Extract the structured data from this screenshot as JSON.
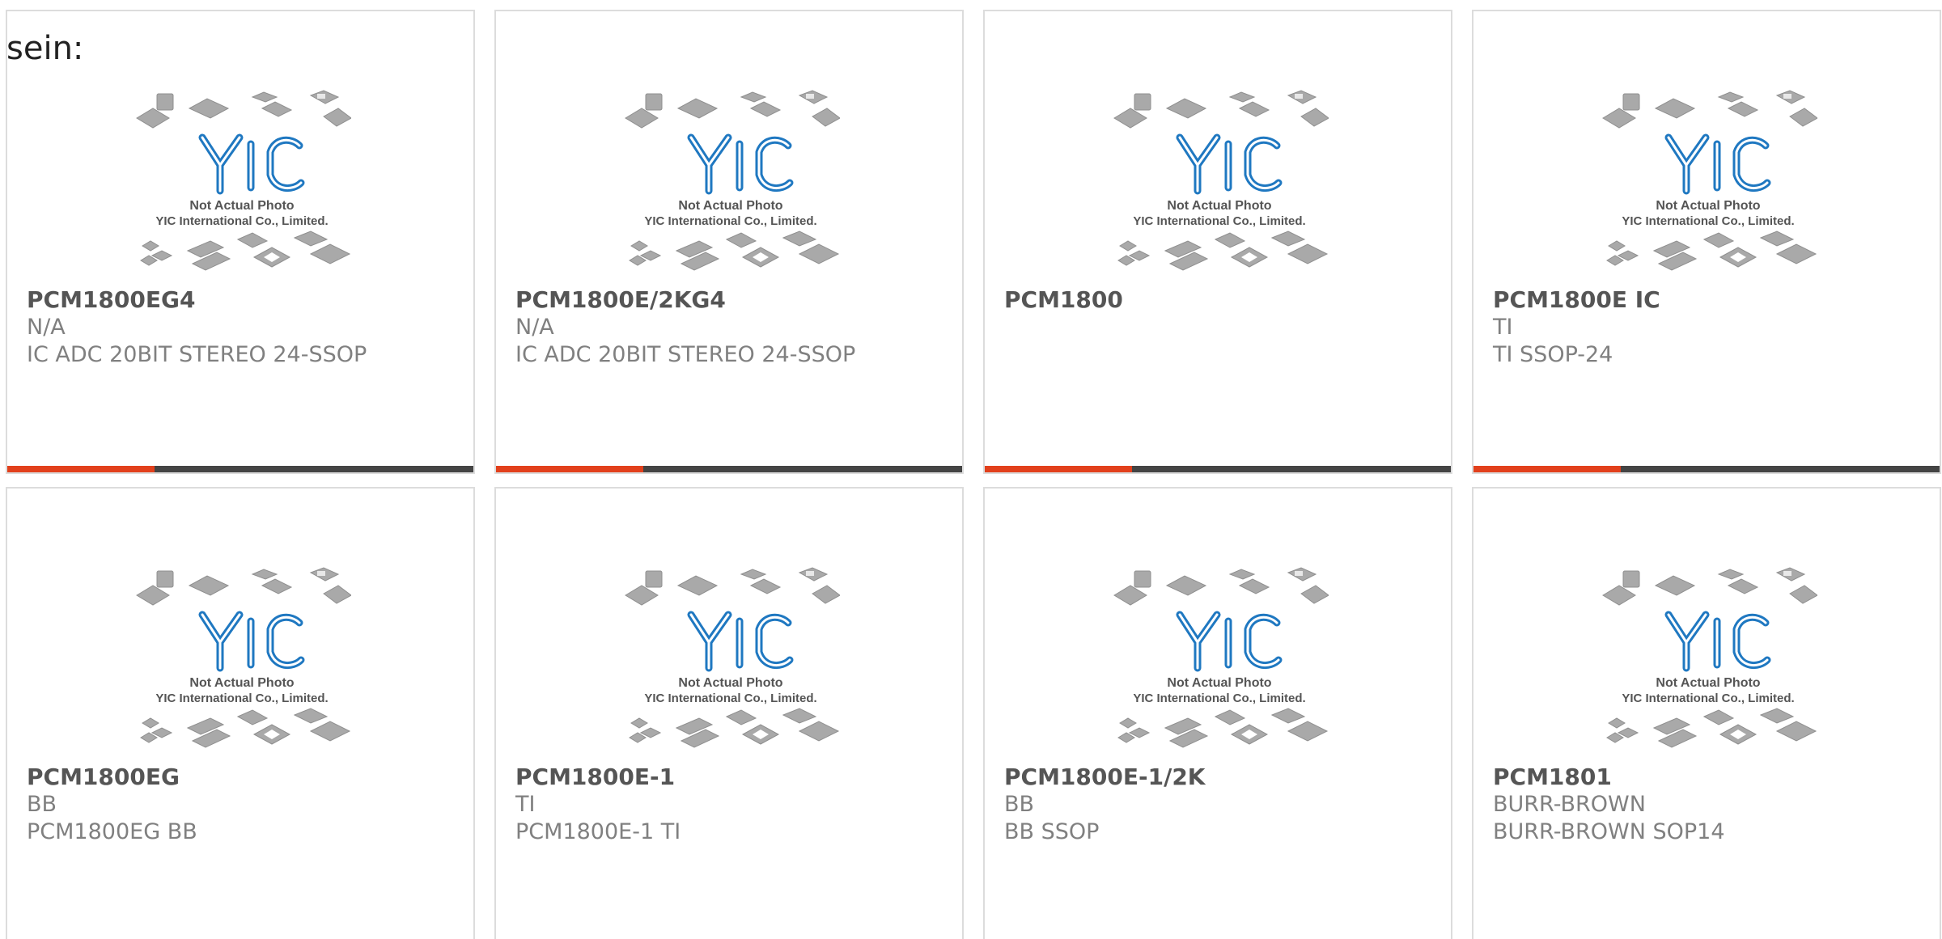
{
  "heading": "sein:",
  "placeholder": {
    "logo_text": "YIC",
    "caption_line1": "Not Actual Photo",
    "caption_line2": "YIC International Co., Limited."
  },
  "colors": {
    "accent": "#e2401c",
    "bar": "#444444",
    "logo_blue": "#1f78c1",
    "border": "#dcdcdc"
  },
  "products": [
    {
      "part": "PCM1800EG4",
      "maker": "N/A",
      "desc": "IC ADC 20BIT STEREO 24-SSOP",
      "show_bar": true
    },
    {
      "part": "PCM1800E/2KG4",
      "maker": "N/A",
      "desc": "IC ADC 20BIT STEREO 24-SSOP",
      "show_bar": true
    },
    {
      "part": "PCM1800",
      "maker": "",
      "desc": "",
      "show_bar": true
    },
    {
      "part": "PCM1800E IC",
      "maker": "TI",
      "desc": "TI SSOP-24",
      "show_bar": true
    },
    {
      "part": "PCM1800EG",
      "maker": "BB",
      "desc": "PCM1800EG BB",
      "show_bar": false
    },
    {
      "part": "PCM1800E-1",
      "maker": "TI",
      "desc": "PCM1800E-1 TI",
      "show_bar": false
    },
    {
      "part": "PCM1800E-1/2K",
      "maker": "BB",
      "desc": "BB SSOP",
      "show_bar": false
    },
    {
      "part": "PCM1801",
      "maker": "BURR-BROWN",
      "desc": "BURR-BROWN SOP14",
      "show_bar": false
    }
  ]
}
